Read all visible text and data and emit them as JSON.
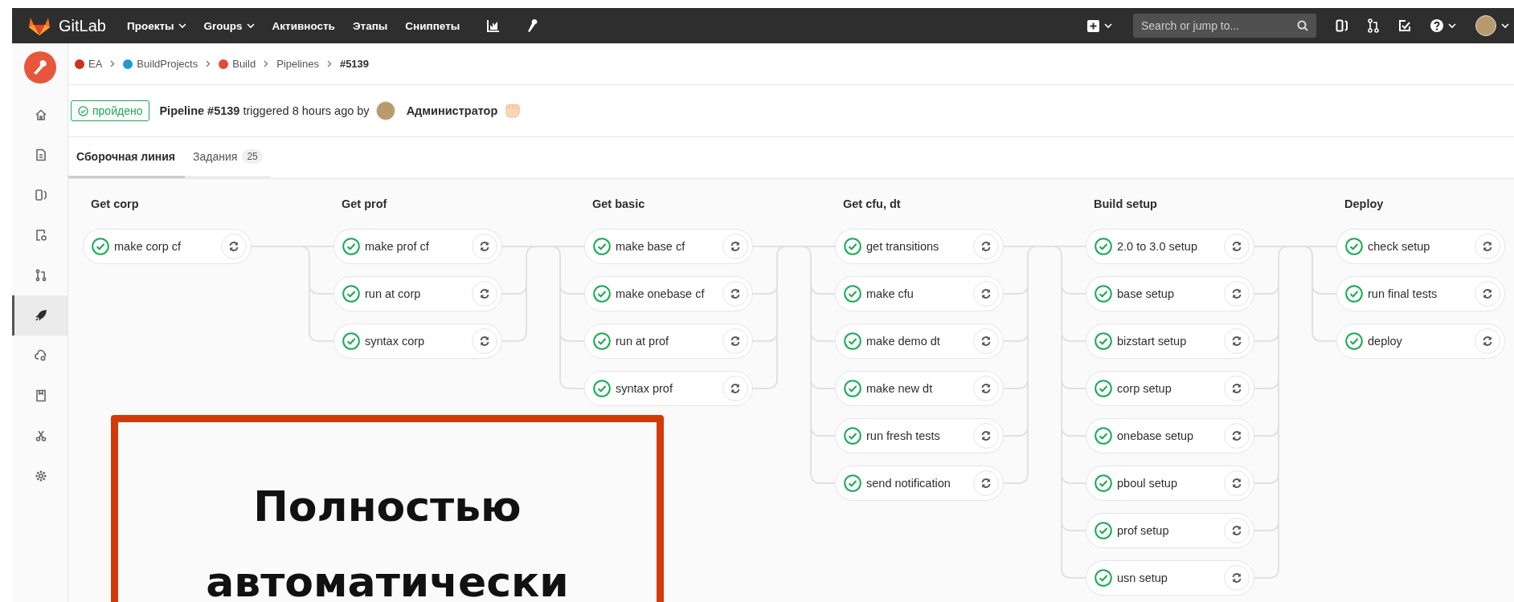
{
  "top_bar": {
    "brand": "GitLab",
    "nav": [
      {
        "label": "Проекты",
        "dropdown": true
      },
      {
        "label": "Groups",
        "dropdown": true
      },
      {
        "label": "Активность",
        "dropdown": false
      },
      {
        "label": "Этапы",
        "dropdown": false
      },
      {
        "label": "Сниппеты",
        "dropdown": false
      }
    ],
    "search": {
      "placeholder": "Search or jump to..."
    }
  },
  "sidebar": {
    "items": [
      {
        "selected": false
      },
      {
        "selected": false
      },
      {
        "selected": false
      },
      {
        "selected": false
      },
      {
        "selected": false
      },
      {
        "selected": true
      },
      {
        "selected": false
      },
      {
        "selected": false
      },
      {
        "selected": false
      },
      {
        "selected": false
      }
    ]
  },
  "breadcrumb": [
    {
      "label": "EA",
      "color": "#d22f1e",
      "current": false
    },
    {
      "label": "BuildProjects",
      "color": "#1f9ad6",
      "current": false
    },
    {
      "label": "Build",
      "color": "#e24a3b",
      "current": false
    },
    {
      "label": "Pipelines",
      "current": false
    },
    {
      "label": "#5139",
      "current": true
    }
  ],
  "header": {
    "status": {
      "label": "пройдено",
      "kind": "success"
    },
    "summary": "**Pipeline #5139** triggered 8 hours ago by",
    "user": "Администратор"
  },
  "tabs": [
    {
      "label": "Сборочная линия",
      "selected": true
    },
    {
      "label": "Задания",
      "count": "25",
      "selected": false
    }
  ],
  "stages": [
    {
      "title": "Get corp",
      "jobs": [
        {
          "name": "make corp cf",
          "passed": true
        }
      ]
    },
    {
      "title": "Get prof",
      "jobs": [
        {
          "name": "make prof cf",
          "passed": true
        },
        {
          "name": "run at corp",
          "passed": true
        },
        {
          "name": "syntax corp",
          "passed": true
        }
      ]
    },
    {
      "title": "Get basic",
      "jobs": [
        {
          "name": "make base cf",
          "passed": true
        },
        {
          "name": "make onebase cf",
          "passed": true
        },
        {
          "name": "run at prof",
          "passed": true
        },
        {
          "name": "syntax prof",
          "passed": true
        }
      ]
    },
    {
      "title": "Get cfu, dt",
      "jobs": [
        {
          "name": "get transitions",
          "passed": true
        },
        {
          "name": "make cfu",
          "passed": true
        },
        {
          "name": "make demo dt",
          "passed": true
        },
        {
          "name": "make new dt",
          "passed": true
        },
        {
          "name": "run fresh tests",
          "passed": true
        },
        {
          "name": "send notification",
          "passed": true
        }
      ]
    },
    {
      "title": "Build setup",
      "jobs": [
        {
          "name": "2.0 to 3.0 setup",
          "passed": true
        },
        {
          "name": "base setup",
          "passed": true
        },
        {
          "name": "bizstart setup",
          "passed": true
        },
        {
          "name": "corp setup",
          "passed": true
        },
        {
          "name": "onebase setup",
          "passed": true
        },
        {
          "name": "pboul setup",
          "passed": true
        },
        {
          "name": "prof setup",
          "passed": true
        },
        {
          "name": "usn setup",
          "passed": true
        }
      ]
    },
    {
      "title": "Deploy",
      "jobs": [
        {
          "name": "check setup",
          "passed": true
        },
        {
          "name": "run final tests",
          "passed": true
        },
        {
          "name": "deploy",
          "passed": true
        }
      ]
    }
  ],
  "overlay": {
    "text": "Полностью автоматически"
  }
}
